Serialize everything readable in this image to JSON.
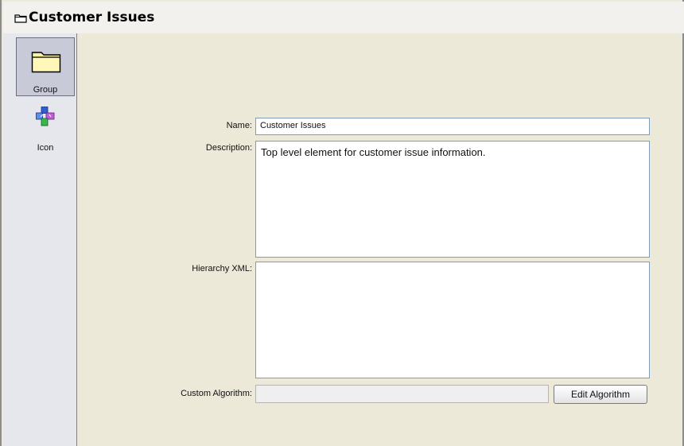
{
  "header": {
    "title": "Customer Issues",
    "icon": "folder-icon"
  },
  "sidebar": {
    "items": [
      {
        "label": "Group",
        "icon": "folder-icon",
        "selected": true
      },
      {
        "label": "Icon",
        "icon": "puzzle-pieces-icon",
        "selected": false
      }
    ]
  },
  "form": {
    "name_label": "Name:",
    "name_value": "Customer Issues",
    "description_label": "Description:",
    "description_value": "Top level element for customer issue information.",
    "hierarchy_label": "Hierarchy XML:",
    "hierarchy_value": "",
    "algorithm_label": "Custom Algorithm:",
    "algorithm_value": "",
    "edit_algorithm_button": "Edit Algorithm"
  },
  "colors": {
    "panel_bg": "#ece9d8",
    "sidebar_bg": "#e6e6ed",
    "selected_bg": "#c8cad7",
    "input_border": "#7f9db9"
  }
}
